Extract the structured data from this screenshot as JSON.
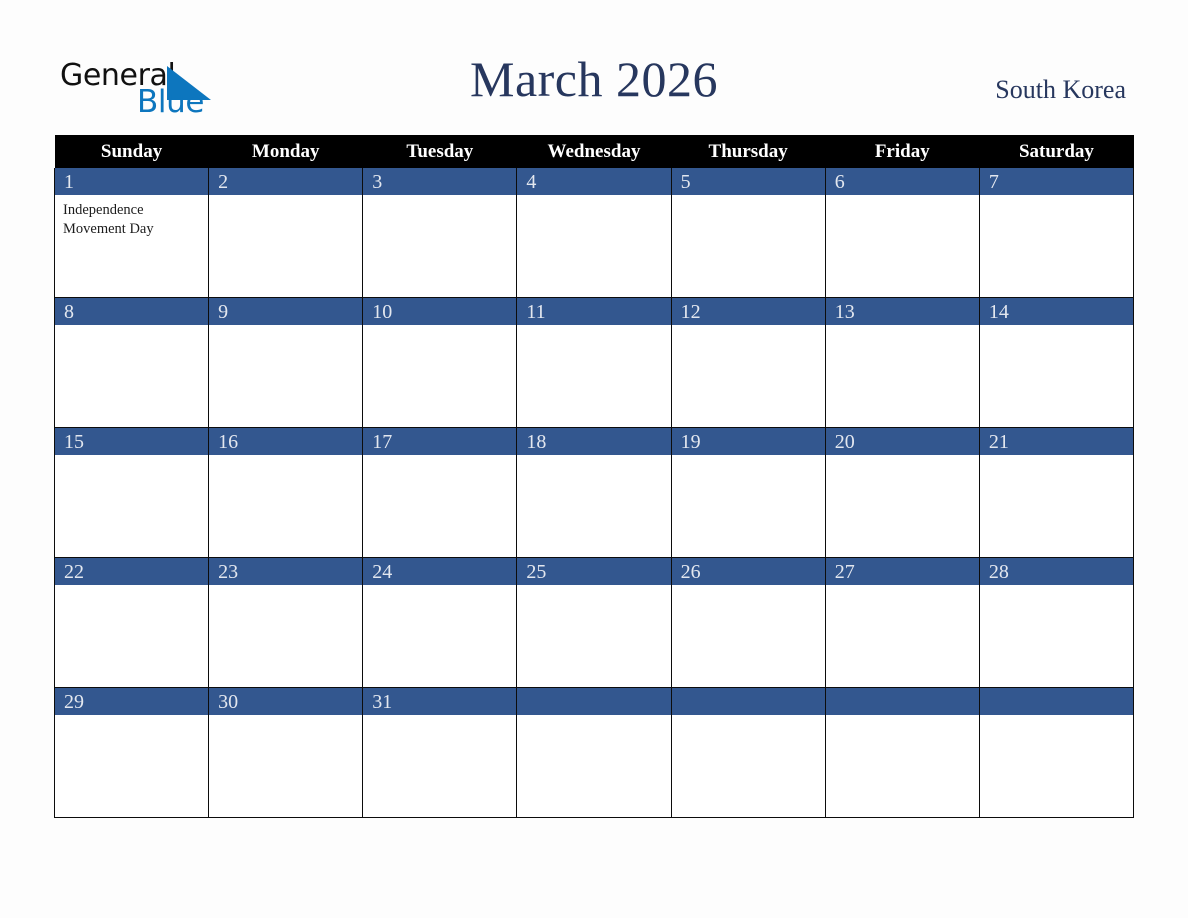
{
  "brand": {
    "name_part1": "General",
    "name_part2": "Blue",
    "triangle_color": "#0d76be",
    "text_color_primary": "#111111",
    "text_color_accent": "#0d76be"
  },
  "header": {
    "title": "March 2026",
    "country": "South Korea",
    "title_color": "#27375e"
  },
  "calendar": {
    "month": "March",
    "year": "2026",
    "weekday_headers": [
      "Sunday",
      "Monday",
      "Tuesday",
      "Wednesday",
      "Thursday",
      "Friday",
      "Saturday"
    ],
    "header_bg_color": "#000000",
    "header_text_color": "#ffffff",
    "date_band_color": "#33578f",
    "date_text_color": "#e3e7ef",
    "cell_bg_color": "#ffffff",
    "border_color": "#0c0c0c",
    "weeks": [
      [
        {
          "day": "1",
          "has_band": true,
          "events": [
            "Independence Movement Day"
          ]
        },
        {
          "day": "2",
          "has_band": true,
          "events": []
        },
        {
          "day": "3",
          "has_band": true,
          "events": []
        },
        {
          "day": "4",
          "has_band": true,
          "events": []
        },
        {
          "day": "5",
          "has_band": true,
          "events": []
        },
        {
          "day": "6",
          "has_band": true,
          "events": []
        },
        {
          "day": "7",
          "has_band": true,
          "events": []
        }
      ],
      [
        {
          "day": "8",
          "has_band": true,
          "events": []
        },
        {
          "day": "9",
          "has_band": true,
          "events": []
        },
        {
          "day": "10",
          "has_band": true,
          "events": []
        },
        {
          "day": "11",
          "has_band": true,
          "events": []
        },
        {
          "day": "12",
          "has_band": true,
          "events": []
        },
        {
          "day": "13",
          "has_band": true,
          "events": []
        },
        {
          "day": "14",
          "has_band": true,
          "events": []
        }
      ],
      [
        {
          "day": "15",
          "has_band": true,
          "events": []
        },
        {
          "day": "16",
          "has_band": true,
          "events": []
        },
        {
          "day": "17",
          "has_band": true,
          "events": []
        },
        {
          "day": "18",
          "has_band": true,
          "events": []
        },
        {
          "day": "19",
          "has_band": true,
          "events": []
        },
        {
          "day": "20",
          "has_band": true,
          "events": []
        },
        {
          "day": "21",
          "has_band": true,
          "events": []
        }
      ],
      [
        {
          "day": "22",
          "has_band": true,
          "events": []
        },
        {
          "day": "23",
          "has_band": true,
          "events": []
        },
        {
          "day": "24",
          "has_band": true,
          "events": []
        },
        {
          "day": "25",
          "has_band": true,
          "events": []
        },
        {
          "day": "26",
          "has_band": true,
          "events": []
        },
        {
          "day": "27",
          "has_band": true,
          "events": []
        },
        {
          "day": "28",
          "has_band": true,
          "events": []
        }
      ],
      [
        {
          "day": "29",
          "has_band": true,
          "events": []
        },
        {
          "day": "30",
          "has_band": true,
          "events": []
        },
        {
          "day": "31",
          "has_band": true,
          "events": []
        },
        {
          "day": "",
          "has_band": true,
          "events": []
        },
        {
          "day": "",
          "has_band": true,
          "events": []
        },
        {
          "day": "",
          "has_band": true,
          "events": []
        },
        {
          "day": "",
          "has_band": true,
          "events": []
        }
      ]
    ]
  }
}
